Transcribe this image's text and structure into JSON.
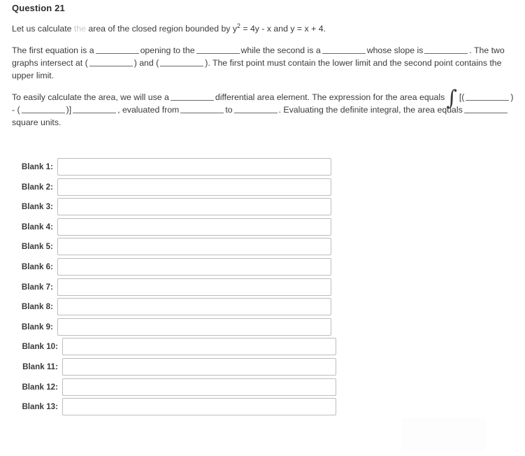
{
  "question": {
    "title": "Question 21",
    "intro": {
      "before_faded": "Let us calculate ",
      "faded_word": "the",
      "after_faded": " area of the closed region bounded by y",
      "exponent": "2",
      "equation_tail": " = 4y - x and y = x + 4."
    },
    "paragraph_2": {
      "s1": "The first equation is a",
      "s2": "opening to the",
      "s3": "while the second is a",
      "s4": "whose slope is",
      "s5": ".",
      "s6": "The two graphs intersect at (",
      "s7": ") and (",
      "s8": "). The first point must contain the lower limit and the second point contains the upper limit."
    },
    "paragraph_3": {
      "t1": "To easily calculate the area, we will use a",
      "t2": "differential area element. The expression for the area equals",
      "integral_symbol": "∫",
      "t3": "[(",
      "t4": ") - (",
      "t5": ")]",
      "t6": ", evaluated from",
      "t7": "to",
      "t8": ". Evaluating the definite integral, the area equals",
      "t9": "square units."
    }
  },
  "answer_blanks": {
    "placeholder": "",
    "items": [
      {
        "label": "Blank 1:",
        "value": ""
      },
      {
        "label": "Blank 2:",
        "value": ""
      },
      {
        "label": "Blank 3:",
        "value": ""
      },
      {
        "label": "Blank 4:",
        "value": ""
      },
      {
        "label": "Blank 5:",
        "value": ""
      },
      {
        "label": "Blank 6:",
        "value": ""
      },
      {
        "label": "Blank 7:",
        "value": ""
      },
      {
        "label": "Blank 8:",
        "value": ""
      },
      {
        "label": "Blank 9:",
        "value": ""
      },
      {
        "label": "Blank 10:",
        "value": ""
      },
      {
        "label": "Blank 11:",
        "value": ""
      },
      {
        "label": "Blank 12:",
        "value": ""
      },
      {
        "label": "Blank 13:",
        "value": ""
      }
    ]
  },
  "colors": {
    "page_background": "#ffffff",
    "text": "#3a3a3a",
    "title": "#2d2d2d",
    "input_border": "#bdbdbd",
    "blank_underline": "#6a6a6a"
  }
}
